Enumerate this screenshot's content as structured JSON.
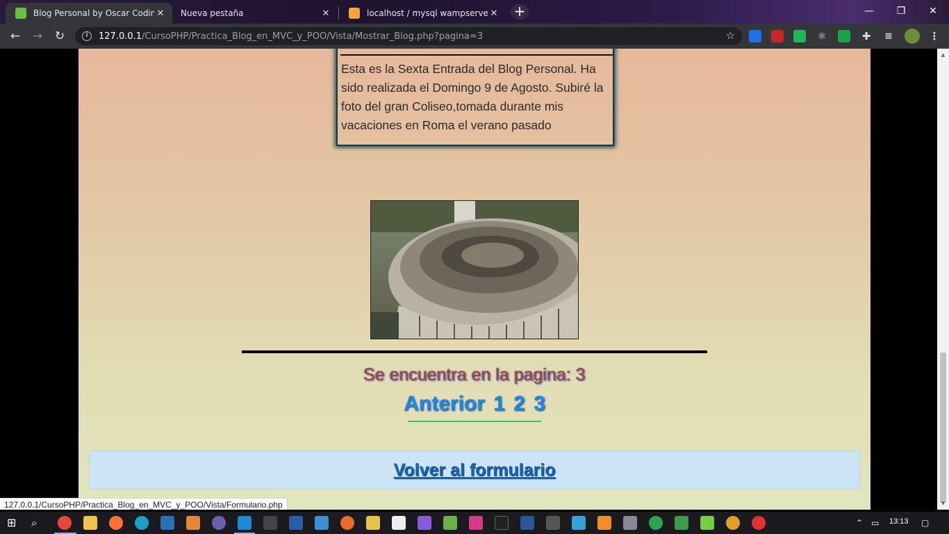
{
  "tabs": [
    {
      "title": "Blog Personal by Oscar Coding®",
      "active": true
    },
    {
      "title": "Nueva pestaña",
      "active": false
    },
    {
      "title": "localhost / mysql wampserver / b",
      "active": false
    }
  ],
  "address_bar": {
    "host": "127.0.0.1",
    "path": "/CursoPHP/Practica_Blog_en_MVC_y_POO/Vista/Mostrar_Blog.php?pagina=3"
  },
  "entry": {
    "text": "Esta es la Sexta Entrada del Blog Personal. Ha sido realizada el Domingo 9 de Agosto. Subiré la foto del gran Coliseo,tomada durante mis vacaciones en Roma el verano pasado"
  },
  "pagination": {
    "status_text": "Se encuentra en la pagina: 3",
    "prev_label": "Anterior",
    "pages": [
      "1",
      "2",
      "3"
    ],
    "current_page": 3
  },
  "return_link": "Volver al formulario",
  "status_url": "127.0.0.1/CursoPHP/Practica_Blog_en_MVC_y_POO/Vista/Formulario.php",
  "clock": "13:13",
  "colors": {
    "status_text": "#c0392b",
    "pager_link": "#1e88e5",
    "return_panel": "#cde4f7"
  }
}
